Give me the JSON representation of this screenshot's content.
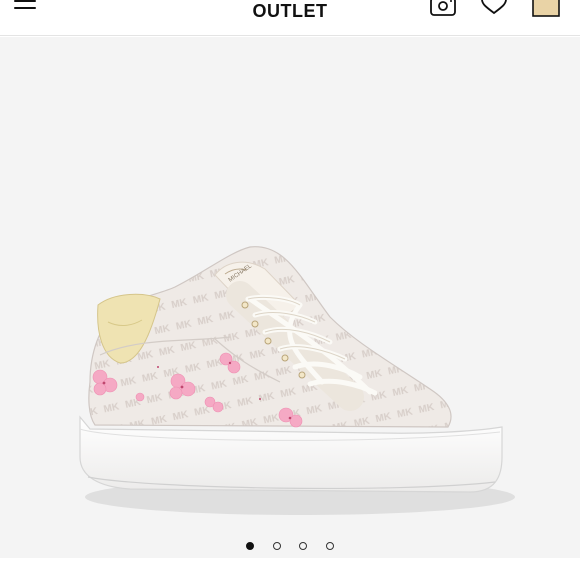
{
  "header": {
    "brand_label": "OUTLET",
    "icons": [
      "menu-icon",
      "camera-search-icon",
      "heart-icon",
      "shopping-bag-icon"
    ],
    "bag_color": "#e9d3a6"
  },
  "gallery": {
    "image": "sneaker-product-image",
    "background": "#f4f4f4",
    "slide_count": 4,
    "active_slide": 1
  }
}
